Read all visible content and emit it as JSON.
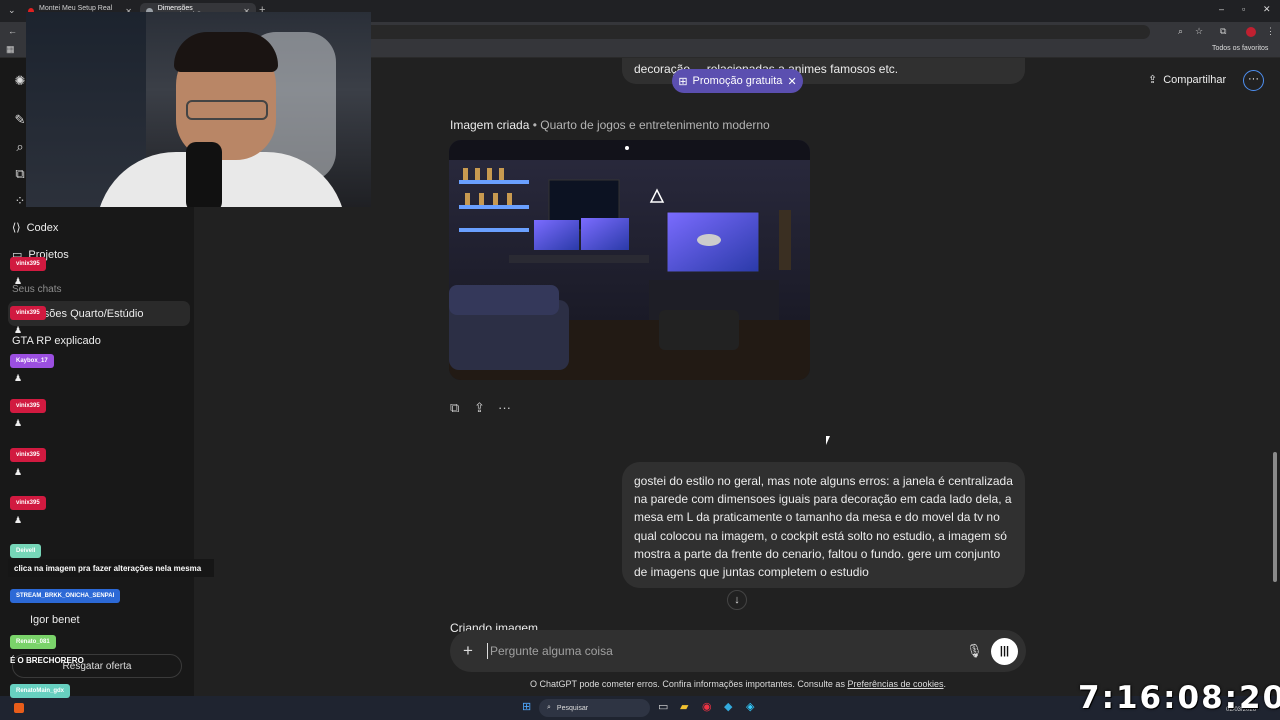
{
  "browser": {
    "tabs": [
      {
        "title": "Montei Meu Setup Real no My"
      },
      {
        "title": "Dimensões Quarto/Estúdio"
      }
    ],
    "bookmarks_label": "Todos os favoritos"
  },
  "sidebar": {
    "items": [
      {
        "label": "Codex"
      },
      {
        "label": "Projetos"
      }
    ],
    "section_label": "Seus chats",
    "chats": [
      {
        "label": "Dimensões Quarto/Estúdio"
      },
      {
        "label": "GTA RP explicado"
      },
      {
        "label": "Igor benet"
      }
    ],
    "upgrade_label": "Resgatar oferta"
  },
  "stream_chat": {
    "badges": [
      {
        "user": "vinix395",
        "color": "#d11a40"
      },
      {
        "user": "vinix395",
        "color": "#d11a40"
      },
      {
        "user": "Kaybox_17",
        "color": "#9b4fe0"
      },
      {
        "user": "vinix395",
        "color": "#d11a40"
      },
      {
        "user": "vinix395",
        "color": "#d11a40"
      },
      {
        "user": "vinix395",
        "color": "#d11a40"
      },
      {
        "user": "Deivell",
        "color": "#76d6b8"
      },
      {
        "user": "STREAM_BRKK_ONICHA_SENPAI",
        "color": "#2c69d6"
      },
      {
        "user": "Renato_081",
        "color": "#7ad36a"
      },
      {
        "user": "RenatoMain_gdx",
        "color": "#67d0c0"
      }
    ],
    "message": "clica na imagem pra fazer alterações nela mesma",
    "message2": "É O BRECHORERO"
  },
  "header": {
    "promo_label": "Promoção gratuita",
    "share_label": "Compartilhar"
  },
  "conversation": {
    "previous_fragment": "decoração ... relacionadas a animes famosos etc.",
    "image_caption_title": "Imagem criada",
    "image_caption_sub": " • Quarto de jogos e entretenimento moderno",
    "user_message": "gostei do estilo no geral, mas note alguns erros: a janela é centralizada na parede com dimensoes iguais para decoração em cada lado dela, a mesa em L da praticamente o tamanho da mesa e do movel da tv no qual colocou na imagem, o cockpit está solto no estudio, a imagem só mostra a parte da frente do cenario, faltou o fundo. gere um conjunto de imagens que juntas completem o estudio",
    "status": "Criando imagem"
  },
  "composer": {
    "placeholder": "Pergunte alguma coisa"
  },
  "footer": {
    "disclaimer": "O ChatGPT pode cometer erros. Confira informações importantes. Consulte as ",
    "link": "Preferências de cookies",
    "end": "."
  },
  "taskbar": {
    "search_label": "Pesquisar",
    "date": "02/03/2026"
  },
  "stream_clock": "7:16:08:20",
  "colors": {
    "accent": "#5b4fb0",
    "background": "#212121",
    "sidebar": "#181818"
  }
}
